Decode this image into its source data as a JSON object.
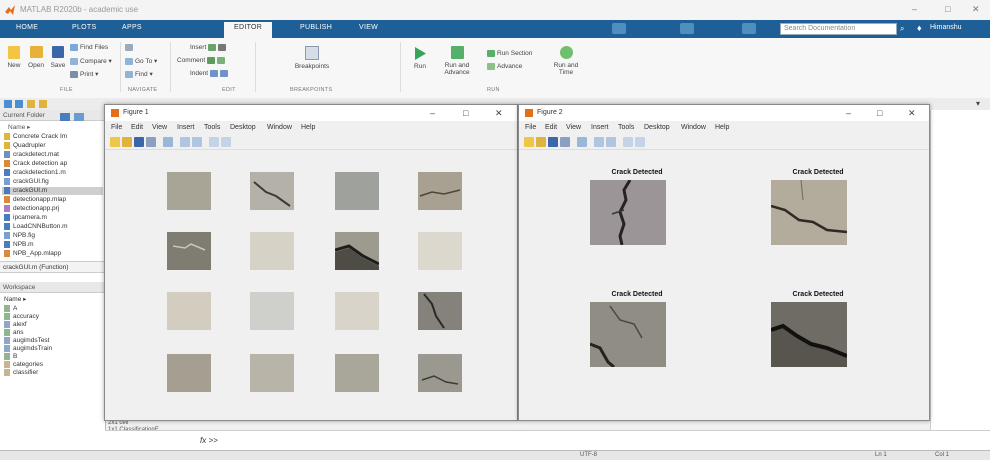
{
  "window": {
    "title": "MATLAB R2020b - academic use",
    "controls": [
      "–",
      "□",
      "✕"
    ]
  },
  "ribbon": {
    "tabs": [
      "HOME",
      "PLOTS",
      "APPS",
      "EDITOR",
      "PUBLISH",
      "VIEW"
    ],
    "active_tab": "EDITOR",
    "search_placeholder": "Search Documentation",
    "user": "Himanshu",
    "file_section": {
      "label": "FILE",
      "new": "New",
      "open": "Open",
      "save": "Save",
      "find_files": "Find Files",
      "compare": "Compare ▾",
      "print": "Print ▾"
    },
    "navigate_section": {
      "label": "NAVIGATE",
      "go_to": "Go To ▾",
      "find": "Find ▾"
    },
    "edit_section": {
      "label": "EDIT",
      "insert": "Insert",
      "comment": "Comment",
      "indent": "Indent"
    },
    "breakpoints_section": {
      "label": "BREAKPOINTS",
      "breakpoints": "Breakpoints"
    },
    "run_section": {
      "label": "RUN",
      "run": "Run",
      "run_and_advance": "Run and Advance",
      "run_section": "Run Section",
      "advance": "Advance",
      "run_and_time": "Run and Time"
    }
  },
  "current_folder": {
    "title": "Current Folder",
    "header": "Name ▸",
    "items": [
      "Concrete Crack Im",
      "Quadrupler",
      "crackdetect.mat",
      "Crack detection ap",
      "crackdetection1.m",
      "crackGUI.fig",
      "crackGUI.m",
      "detectionapp.mlap",
      "detectionapp.prj",
      "ipcamera.m",
      "LoadCNNButton.m",
      "NPB.fig",
      "NPB.m",
      "NPB_App.mlapp"
    ],
    "selected": "crackGUI.m",
    "details": "crackGUI.m  (Function)"
  },
  "workspace": {
    "title": "Workspace",
    "header": "Name ▸",
    "items": [
      "A",
      "accuracy",
      "alexf",
      "ans",
      "augimdsTest",
      "augimdsTrain",
      "B",
      "categories",
      "classifier"
    ],
    "values": [
      "",
      "",
      "",
      "",
      "",
      "",
      "",
      "2x1 cell",
      "1x1 ClassificationE..."
    ]
  },
  "figure1": {
    "title": "Figure 1",
    "menu": [
      "File",
      "Edit",
      "View",
      "Insert",
      "Tools",
      "Desktop",
      "Window",
      "Help"
    ]
  },
  "figure2": {
    "title": "Figure 2",
    "menu": [
      "File",
      "Edit",
      "View",
      "Insert",
      "Tools",
      "Desktop",
      "Window",
      "Help"
    ],
    "panel_titles": [
      "Crack Detected",
      "Crack Detected",
      "Crack Detected",
      "Crack Detected"
    ]
  },
  "command_window": {
    "prompt": "fx >>"
  },
  "status_bar": {
    "encoding": "UTF-8",
    "line": "Ln 1",
    "col": "Col 1"
  },
  "colors": {
    "ribbon_blue": "#1d5f96",
    "matlab_orange": "#e46f1b"
  }
}
